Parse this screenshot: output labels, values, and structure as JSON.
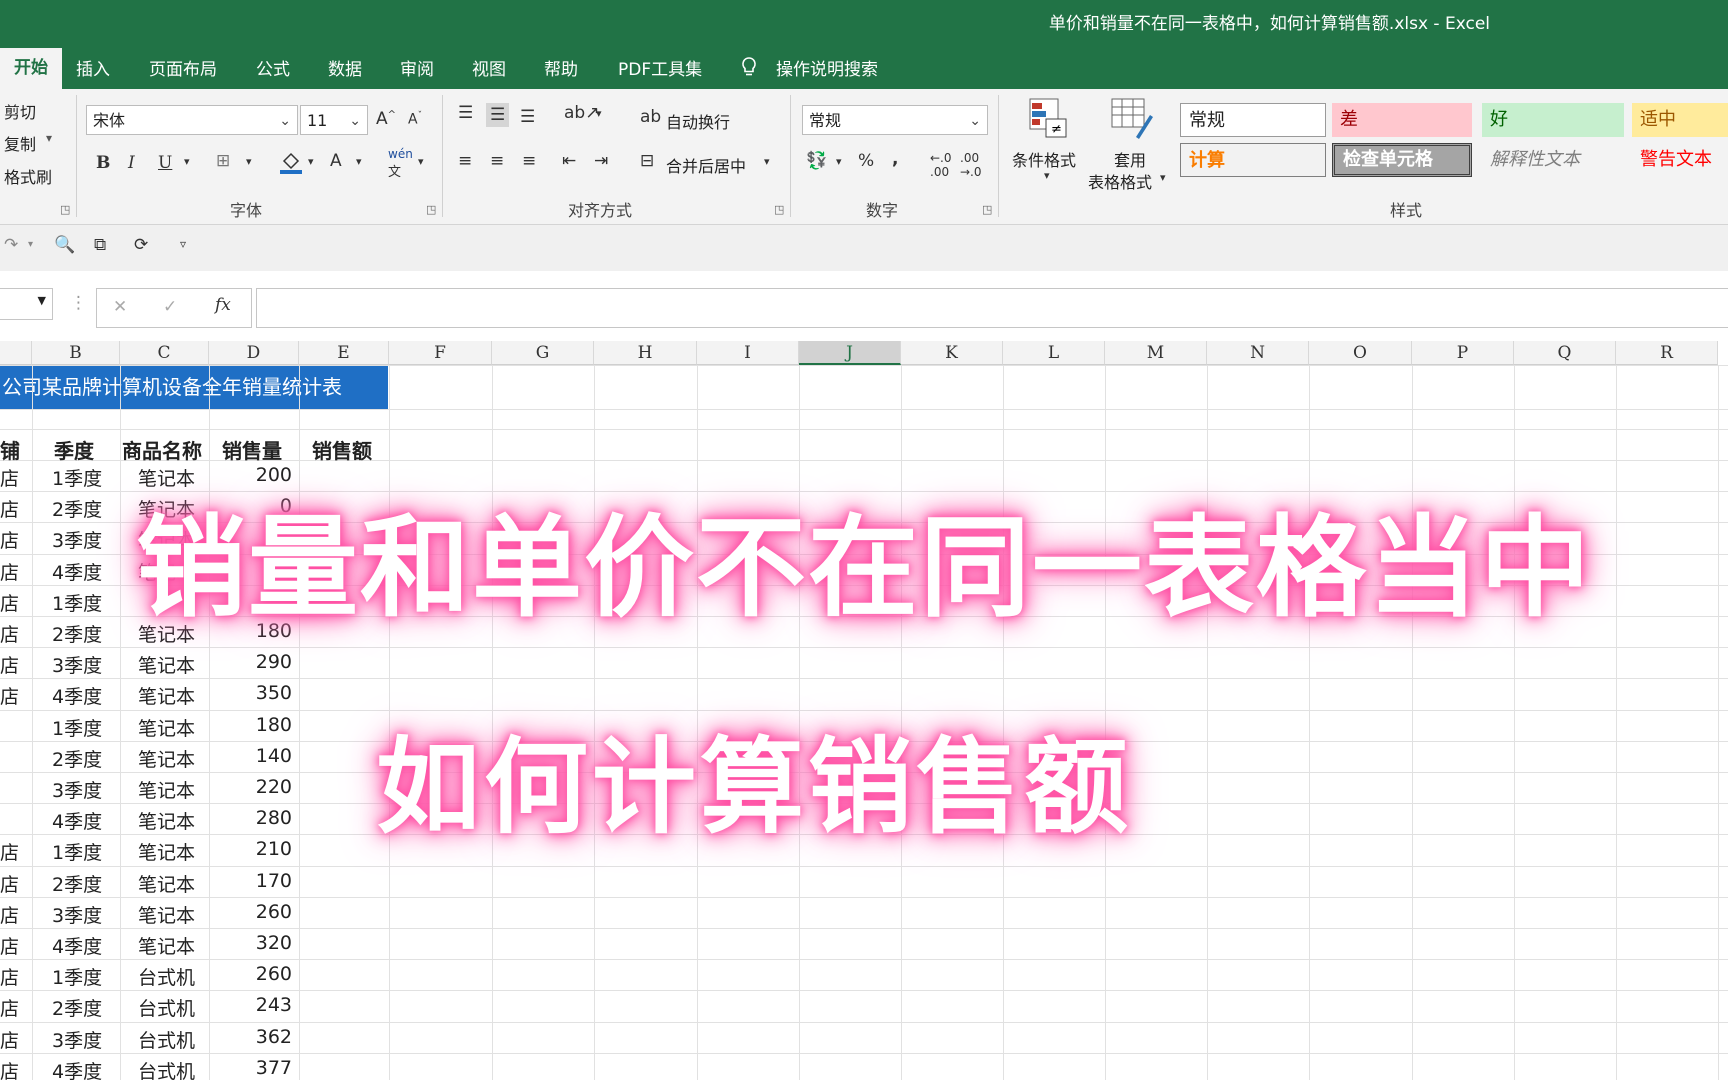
{
  "window": {
    "title": "单价和销量不在同一表格中，如何计算销售额.xlsx  -  Excel"
  },
  "tabs": [
    {
      "label": "开始",
      "active": true
    },
    {
      "label": "插入"
    },
    {
      "label": "页面布局"
    },
    {
      "label": "公式"
    },
    {
      "label": "数据"
    },
    {
      "label": "审阅"
    },
    {
      "label": "视图"
    },
    {
      "label": "帮助"
    },
    {
      "label": "PDF工具集"
    }
  ],
  "search": {
    "label": "操作说明搜索"
  },
  "clipboard": {
    "cut": "剪切",
    "copy": "复制",
    "format_painter": "格式刷"
  },
  "font": {
    "name": "宋体",
    "size": "11",
    "group_label": "字体",
    "bold": "B",
    "italic": "I",
    "underline": "U",
    "grow": "A",
    "shrink": "A",
    "color": "A",
    "phonetic": "wén"
  },
  "alignment": {
    "wrap_text": "自动换行",
    "merge_center": "合并后居中",
    "group_label": "对齐方式"
  },
  "number": {
    "format": "常规",
    "percent": "%",
    "comma": ",",
    "group_label": "数字"
  },
  "styles_group": {
    "conditional_format": "条件格式",
    "table_format_line1": "套用",
    "table_format_line2": "表格格式",
    "group_label": "样式",
    "cells": [
      {
        "label": "常规"
      },
      {
        "label": "差"
      },
      {
        "label": "好"
      },
      {
        "label": "适中"
      },
      {
        "label": "计算"
      },
      {
        "label": "检查单元格"
      },
      {
        "label": "解释性文本"
      },
      {
        "label": "警告文本"
      }
    ]
  },
  "formula_bar": {
    "cancel": "✕",
    "enter": "✓",
    "fx": "fx",
    "value": ""
  },
  "columns": [
    "B",
    "C",
    "D",
    "E",
    "F",
    "G",
    "H",
    "I",
    "J",
    "K",
    "L",
    "M",
    "N",
    "O",
    "P",
    "Q",
    "R"
  ],
  "selected_column": "J",
  "sheet": {
    "banner": "公司某品牌计算机设备全年销量统计表",
    "headers": {
      "a": "铺",
      "b": "季度",
      "c": "商品名称",
      "d": "销售量",
      "e": "销售额"
    },
    "rows": [
      {
        "a": "店",
        "b": "1季度",
        "c": "笔记本",
        "d": "200"
      },
      {
        "a": "店",
        "b": "2季度",
        "c": "笔记本",
        "d": "0"
      },
      {
        "a": "店",
        "b": "3季度",
        "c": "笔记本",
        "d": ""
      },
      {
        "a": "店",
        "b": "4季度",
        "c": "笔记本",
        "d": ""
      },
      {
        "a": "店",
        "b": "1季度",
        "c": "",
        "d": ""
      },
      {
        "a": "店",
        "b": "2季度",
        "c": "笔记本",
        "d": "180"
      },
      {
        "a": "店",
        "b": "3季度",
        "c": "笔记本",
        "d": "290"
      },
      {
        "a": "店",
        "b": "4季度",
        "c": "笔记本",
        "d": "350"
      },
      {
        "a": "",
        "b": "1季度",
        "c": "笔记本",
        "d": "180"
      },
      {
        "a": "",
        "b": "2季度",
        "c": "笔记本",
        "d": "140"
      },
      {
        "a": "",
        "b": "3季度",
        "c": "笔记本",
        "d": "220"
      },
      {
        "a": "",
        "b": "4季度",
        "c": "笔记本",
        "d": "280"
      },
      {
        "a": "店",
        "b": "1季度",
        "c": "笔记本",
        "d": "210"
      },
      {
        "a": "店",
        "b": "2季度",
        "c": "笔记本",
        "d": "170"
      },
      {
        "a": "店",
        "b": "3季度",
        "c": "笔记本",
        "d": "260"
      },
      {
        "a": "店",
        "b": "4季度",
        "c": "笔记本",
        "d": "320"
      },
      {
        "a": "店",
        "b": "1季度",
        "c": "台式机",
        "d": "260"
      },
      {
        "a": "店",
        "b": "2季度",
        "c": "台式机",
        "d": "243"
      },
      {
        "a": "店",
        "b": "3季度",
        "c": "台式机",
        "d": "362"
      },
      {
        "a": "店",
        "b": "4季度",
        "c": "台式机",
        "d": "377"
      }
    ]
  },
  "overlay": {
    "line1": "销量和单价不在同一表格当中",
    "line2": "如何计算销售额"
  },
  "colors": {
    "excel_green": "#217346",
    "banner_blue": "#1f6fc5",
    "glow_pink": "#ff4fa3"
  }
}
